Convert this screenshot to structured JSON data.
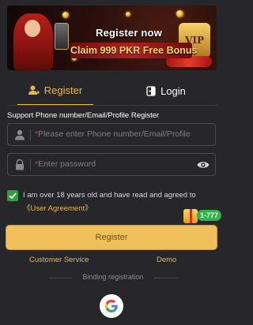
{
  "banner": {
    "line1": "Register now",
    "line2": "Claim 999 PKR Free Bonus",
    "vip_label": "VIP"
  },
  "tabs": [
    {
      "label": "Register",
      "icon": "user-plus-icon",
      "active": true
    },
    {
      "label": "Login",
      "icon": "login-door-icon",
      "active": false
    }
  ],
  "form": {
    "support_label": "Support Phone number/Email/Profile Register",
    "account_placeholder": "Please enter Phone number/Email/Profile",
    "password_placeholder": "Enter password",
    "required_mark": "*"
  },
  "agreement": {
    "text": "I am over 18 years old and have read and agreed to ",
    "link": "《User Agreement》",
    "checked": true
  },
  "promo_badge": "1-777",
  "register_button": "Register",
  "links": {
    "customer_service": "Customer Service",
    "demo": "Demo"
  },
  "binding_label": "Binding registration",
  "colors": {
    "accent": "#e6b84a",
    "button": "#f0c05a",
    "background": "#27272b",
    "check": "#2e9e3e"
  }
}
